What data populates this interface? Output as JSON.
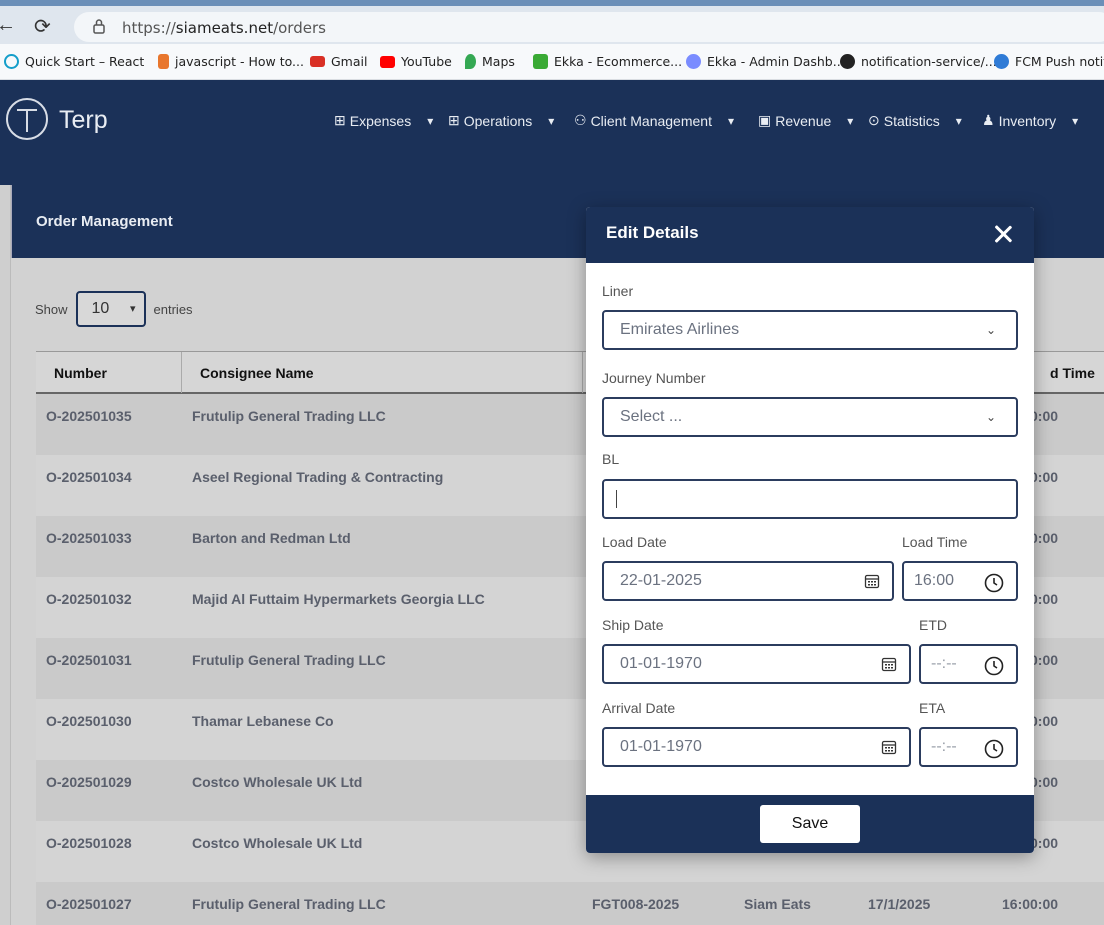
{
  "browser": {
    "url_protocol": "https://",
    "url_host": "siameats.net",
    "url_path": "/orders",
    "bookmarks": [
      {
        "label": "Quick Start – React",
        "color": "#149eca"
      },
      {
        "label": "javascript - How to...",
        "color": "#e8762d"
      },
      {
        "label": "Gmail",
        "color": "#d93025"
      },
      {
        "label": "YouTube",
        "color": "#ff0000"
      },
      {
        "label": "Maps",
        "color": "#34a853"
      },
      {
        "label": "Ekka - Ecommerce...",
        "color": "#3aaa35"
      },
      {
        "label": "Ekka - Admin Dashb...",
        "color": "#7a8cff"
      },
      {
        "label": "notification-service/...",
        "color": "#222222"
      },
      {
        "label": "FCM Push notific",
        "color": "#2f7bd6"
      }
    ]
  },
  "app": {
    "logo_text": "Terp",
    "nav": [
      {
        "label": "Expenses",
        "icon": "box-icon"
      },
      {
        "label": "Operations",
        "icon": "box-icon"
      },
      {
        "label": "Client Management",
        "icon": "user-plus-icon"
      },
      {
        "label": "Revenue",
        "icon": "archive-icon"
      },
      {
        "label": "Statistics",
        "icon": "dots-circle-icon"
      },
      {
        "label": "Inventory",
        "icon": "user-icon"
      }
    ]
  },
  "orders": {
    "title": "Order Management",
    "show_label": "Show",
    "entries_value": "10",
    "entries_label": "entries",
    "columns": {
      "number": "Number",
      "consignee": "Consignee Name",
      "time": "d Time"
    },
    "rows": [
      {
        "number": "O-202501035",
        "consignee": "Frutulip General Trading LLC",
        "ref": "",
        "brand": "",
        "date": "",
        "time": "16:00:00"
      },
      {
        "number": "O-202501034",
        "consignee": "Aseel Regional Trading & Contracting",
        "ref": "",
        "brand": "",
        "date": "",
        "time": "16:00:00"
      },
      {
        "number": "O-202501033",
        "consignee": "Barton and Redman Ltd",
        "ref": "",
        "brand": "",
        "date": "",
        "time": "16:00:00"
      },
      {
        "number": "O-202501032",
        "consignee": "Majid Al Futtaim Hypermarkets Georgia LLC",
        "ref": "",
        "brand": "",
        "date": "",
        "time": "16:00:00"
      },
      {
        "number": "O-202501031",
        "consignee": "Frutulip General Trading LLC",
        "ref": "",
        "brand": "",
        "date": "",
        "time": "16:00:00"
      },
      {
        "number": "O-202501030",
        "consignee": "Thamar Lebanese Co",
        "ref": "",
        "brand": "",
        "date": "",
        "time": "16:00:00"
      },
      {
        "number": "O-202501029",
        "consignee": "Costco Wholesale UK Ltd",
        "ref": "",
        "brand": "",
        "date": "",
        "time": "16:00:00"
      },
      {
        "number": "O-202501028",
        "consignee": "Costco Wholesale UK Ltd",
        "ref": "",
        "brand": "",
        "date": "",
        "time": "16:00:00"
      },
      {
        "number": "O-202501027",
        "consignee": "Frutulip General Trading LLC",
        "ref": "FGT008-2025",
        "brand": "Siam Eats",
        "date": "17/1/2025",
        "time": "16:00:00"
      }
    ]
  },
  "modal": {
    "title": "Edit Details",
    "liner_label": "Liner",
    "liner_value": "Emirates Airlines",
    "journey_label": "Journey Number",
    "journey_placeholder": "Select ...",
    "bl_label": "BL",
    "bl_value": "",
    "load_date_label": "Load Date",
    "load_date_value": "22-01-2025",
    "load_time_label": "Load Time",
    "load_time_value": "16:00",
    "ship_date_label": "Ship Date",
    "ship_date_value": "01-01-1970",
    "etd_label": "ETD",
    "etd_value": "--:--",
    "arrival_date_label": "Arrival Date",
    "arrival_date_value": "01-01-1970",
    "eta_label": "ETA",
    "eta_value": "--:--",
    "save_label": "Save"
  },
  "colors": {
    "primary": "#1b3158",
    "accent_border": "#2b3c5e"
  }
}
